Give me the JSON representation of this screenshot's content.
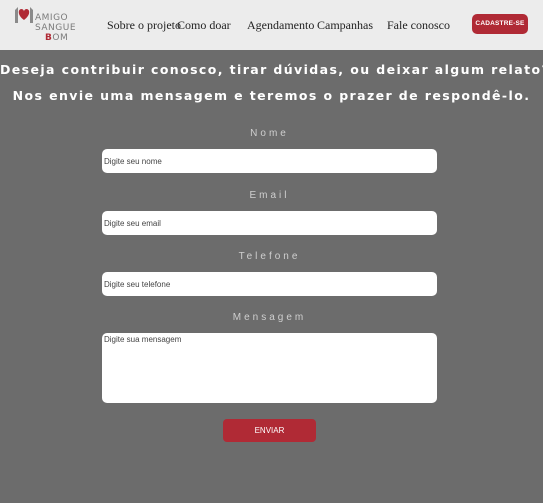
{
  "brand": {
    "line1": "AMIGO",
    "line2": "SANGUE",
    "line3_initial": "B",
    "line3_rest": "OM"
  },
  "nav": {
    "items": [
      "Sobre o projeto",
      "Como doar",
      "Agendamento",
      "Campanhas",
      "Fale conosco"
    ],
    "signup_label": "CADASTRE-SE"
  },
  "headline": {
    "line1": "Deseja contribuir conosco, tirar dúvidas, ou deixar algum relato?",
    "line2": "Nos envie uma mensagem e teremos o prazer de respondê-lo."
  },
  "form": {
    "name": {
      "label": "Nome",
      "placeholder": "Digite seu nome",
      "value": ""
    },
    "email": {
      "label": "Email",
      "placeholder": "Digite seu email",
      "value": ""
    },
    "phone": {
      "label": "Telefone",
      "placeholder": "Digite seu telefone",
      "value": ""
    },
    "message": {
      "label": "Mensagem",
      "placeholder": "Digite sua mensagem",
      "value": ""
    },
    "submit_label": "ENVIAR"
  },
  "colors": {
    "accent": "#b02a35",
    "background": "#6c6c6c",
    "header": "#ececec"
  }
}
